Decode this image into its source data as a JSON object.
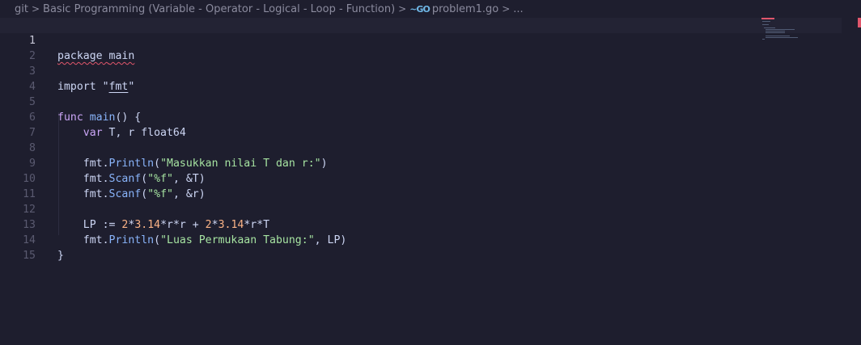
{
  "breadcrumb": {
    "items": [
      "git",
      "Basic Programming (Variable - Operator - Logical - Loop - Function)"
    ],
    "file_icon": "go-icon",
    "file": "problem1.go",
    "ellipsis": "..."
  },
  "editor": {
    "current_line": 1,
    "lines": [
      {
        "n": "1"
      },
      {
        "n": "2"
      },
      {
        "n": "3"
      },
      {
        "n": "4"
      },
      {
        "n": "5"
      },
      {
        "n": "6"
      },
      {
        "n": "7"
      },
      {
        "n": "8"
      },
      {
        "n": "9"
      },
      {
        "n": "10"
      },
      {
        "n": "11"
      },
      {
        "n": "12"
      },
      {
        "n": "13"
      },
      {
        "n": "14"
      },
      {
        "n": "15"
      }
    ],
    "code": {
      "l1": {
        "kw": "package",
        "name": "main"
      },
      "l3": {
        "kw": "import",
        "q1": "\"",
        "pkg": "fmt",
        "q2": "\""
      },
      "l5": {
        "kw": "func",
        "name": "main",
        "rest": "() {"
      },
      "l6": {
        "kw": "var",
        "vars": " T, r ",
        "type": "float64"
      },
      "l8": {
        "obj": "fmt",
        "dot": ".",
        "fn": "Println",
        "open": "(",
        "str": "\"Masukkan nilai T dan r:\"",
        "close": ")"
      },
      "l9": {
        "obj": "fmt",
        "dot": ".",
        "fn": "Scanf",
        "open": "(",
        "str": "\"%f\"",
        "rest": ", &T)"
      },
      "l10": {
        "obj": "fmt",
        "dot": ".",
        "fn": "Scanf",
        "open": "(",
        "str": "\"%f\"",
        "rest": ", &r)"
      },
      "l12": {
        "a": "LP := ",
        "n1": "2",
        "b": "*",
        "n2": "3.14",
        "c": "*r*r + ",
        "n3": "2",
        "d": "*",
        "n4": "3.14",
        "e": "*r*T"
      },
      "l13": {
        "obj": "fmt",
        "dot": ".",
        "fn": "Println",
        "open": "(",
        "str": "\"Luas Permukaan Tabung:\"",
        "rest": ", LP)"
      },
      "l14": {
        "text": "}"
      }
    }
  },
  "colors": {
    "background": "#1e1e2e",
    "keyword": "#cba6f7",
    "function": "#89b4fa",
    "string": "#a6e3a1",
    "number": "#fab387",
    "error": "#e0566b"
  }
}
